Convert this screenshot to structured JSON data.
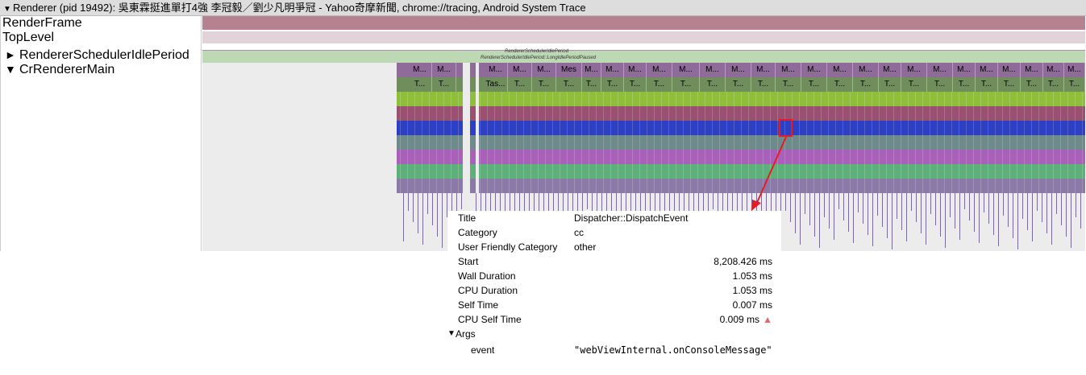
{
  "header": {
    "title": "Renderer (pid 19492): 吳東霖挺進單打4強 李冠毅／劉少凡明爭冠 - Yahoo奇摩新聞, chrome://tracing, Android System Trace"
  },
  "tracks": {
    "render_frame": "RenderFrame",
    "top_level": "TopLevel",
    "idle_period": "RendererSchedulerIdlePeriod",
    "main": "CrRendererMain"
  },
  "idle_slices": {
    "top": "RendererSchedulerIdlePeriod",
    "bottom": "RendererSchedulerIdlePeriod::LongIdlePeriodPaused"
  },
  "level0_labels": [
    "M...",
    "M...",
    "M...",
    "M...",
    "M...",
    "Mes",
    "M...",
    "M...",
    "M...",
    "M...",
    "M...",
    "M...",
    "M...",
    "M...",
    "M...",
    "M...",
    "M...",
    "M...",
    "M...",
    "M...",
    "M...",
    "M...",
    "M...",
    "M...",
    "M...",
    "M..."
  ],
  "level1_labels": [
    "T...",
    "T...",
    "Tas...",
    "T...",
    "T...",
    "T...",
    "T...",
    "T...",
    "T...",
    "T...",
    "T...",
    "T...",
    "T...",
    "T...",
    "T...",
    "T...",
    "T...",
    "T...",
    "T...",
    "T...",
    "T...",
    "T...",
    "T...",
    "T...",
    "T...",
    "T..."
  ],
  "details": {
    "title_key": "Title",
    "title_val": "Dispatcher::DispatchEvent",
    "category_key": "Category",
    "category_val": "cc",
    "ufc_key": "User Friendly Category",
    "ufc_val": "other",
    "start_key": "Start",
    "start_val": "8,208.426 ms",
    "wall_key": "Wall Duration",
    "wall_val": "1.053 ms",
    "cpu_key": "CPU Duration",
    "cpu_val": "1.053 ms",
    "self_key": "Self Time",
    "self_val": "0.007 ms",
    "cpuself_key": "CPU Self Time",
    "cpuself_val": "0.009 ms",
    "args_label": "Args",
    "arg_event_key": "event",
    "arg_event_val": "\"webViewInternal.onConsoleMessage\""
  },
  "colors": {
    "render_frame": "#b5838f",
    "top_level": "#e2d3da",
    "idle": "#bcd9b3",
    "level0": "#8e6b98",
    "level1": "#6f8e5c",
    "level2": "#8fbf3a",
    "level3": "#9a5070",
    "level4": "#2d3fc2",
    "level5": "#6f8a8a",
    "level6": "#a960b8",
    "level7": "#5eb07a",
    "level8": "#8b7aa8",
    "selection": "#e51c23"
  }
}
